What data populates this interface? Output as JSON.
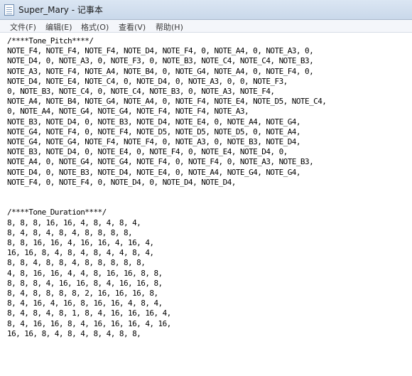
{
  "window": {
    "title": "Super_Mary - 记事本"
  },
  "menu": {
    "file": "文件(F)",
    "edit": "编辑(E)",
    "format": "格式(O)",
    "view": "查看(V)",
    "help": "帮助(H)"
  },
  "document": {
    "lines": [
      "/****Tone_Pitch****/",
      "NOTE_F4, NOTE_F4, NOTE_F4, NOTE_D4, NOTE_F4, 0, NOTE_A4, 0, NOTE_A3, 0,",
      "NOTE_D4, 0, NOTE_A3, 0, NOTE_F3, 0, NOTE_B3, NOTE_C4, NOTE_C4, NOTE_B3,",
      "NOTE_A3, NOTE_F4, NOTE_A4, NOTE_B4, 0, NOTE_G4, NOTE_A4, 0, NOTE_F4, 0,",
      "NOTE_D4, NOTE_E4, NOTE_C4, 0, NOTE_D4, 0, NOTE_A3, 0, 0, NOTE_F3,",
      "0, NOTE_B3, NOTE_C4, 0, NOTE_C4, NOTE_B3, 0, NOTE_A3, NOTE_F4,",
      "NOTE_A4, NOTE_B4, NOTE_G4, NOTE_A4, 0, NOTE_F4, NOTE_E4, NOTE_D5, NOTE_C4,",
      "0, NOTE_A4, NOTE_G4, NOTE_G4, NOTE_F4, NOTE_F4, NOTE_A3,",
      "NOTE_B3, NOTE_D4, 0, NOTE_B3, NOTE_D4, NOTE_E4, 0, NOTE_A4, NOTE_G4,",
      "NOTE_G4, NOTE_F4, 0, NOTE_F4, NOTE_D5, NOTE_D5, NOTE_D5, 0, NOTE_A4,",
      "NOTE_G4, NOTE_G4, NOTE_F4, NOTE_F4, 0, NOTE_A3, 0, NOTE_B3, NOTE_D4,",
      "NOTE_B3, NOTE_D4, 0, NOTE_E4, 0, NOTE_F4, 0, NOTE_E4, NOTE_D4, 0,",
      "NOTE_A4, 0, NOTE_G4, NOTE_G4, NOTE_F4, 0, NOTE_F4, 0, NOTE_A3, NOTE_B3,",
      "NOTE_D4, 0, NOTE_B3, NOTE_D4, NOTE_E4, 0, NOTE_A4, NOTE_G4, NOTE_G4,",
      "NOTE_F4, 0, NOTE_F4, 0, NOTE_D4, 0, NOTE_D4, NOTE_D4,",
      "",
      "",
      "/****Tone_Duration****/",
      "8, 8, 8, 16, 16, 4, 8, 4, 8, 4,",
      "8, 4, 8, 4, 8, 4, 8, 8, 8, 8,",
      "8, 8, 16, 16, 4, 16, 16, 4, 16, 4,",
      "16, 16, 8, 4, 8, 4, 8, 4, 4, 8, 4,",
      "8, 8, 4, 8, 8, 4, 8, 8, 8, 8, 8,",
      "4, 8, 16, 16, 4, 4, 8, 16, 16, 8, 8,",
      "8, 8, 8, 4, 16, 16, 8, 4, 16, 16, 8,",
      "8, 4, 8, 8, 8, 8, 2, 16, 16, 16, 8,",
      "8, 4, 16, 4, 16, 8, 16, 16, 4, 8, 4,",
      "8, 4, 8, 4, 8, 1, 8, 4, 16, 16, 16, 4,",
      "8, 4, 16, 16, 8, 4, 16, 16, 16, 4, 16,",
      "16, 16, 8, 4, 8, 4, 8, 4, 8, 8,"
    ]
  },
  "colors": {
    "titlebar": "#c9d8ea",
    "menubar": "#f4f6fa",
    "editor_background": "#ffffff",
    "text": "#000000"
  },
  "icons": {
    "app": "notepad-icon"
  }
}
